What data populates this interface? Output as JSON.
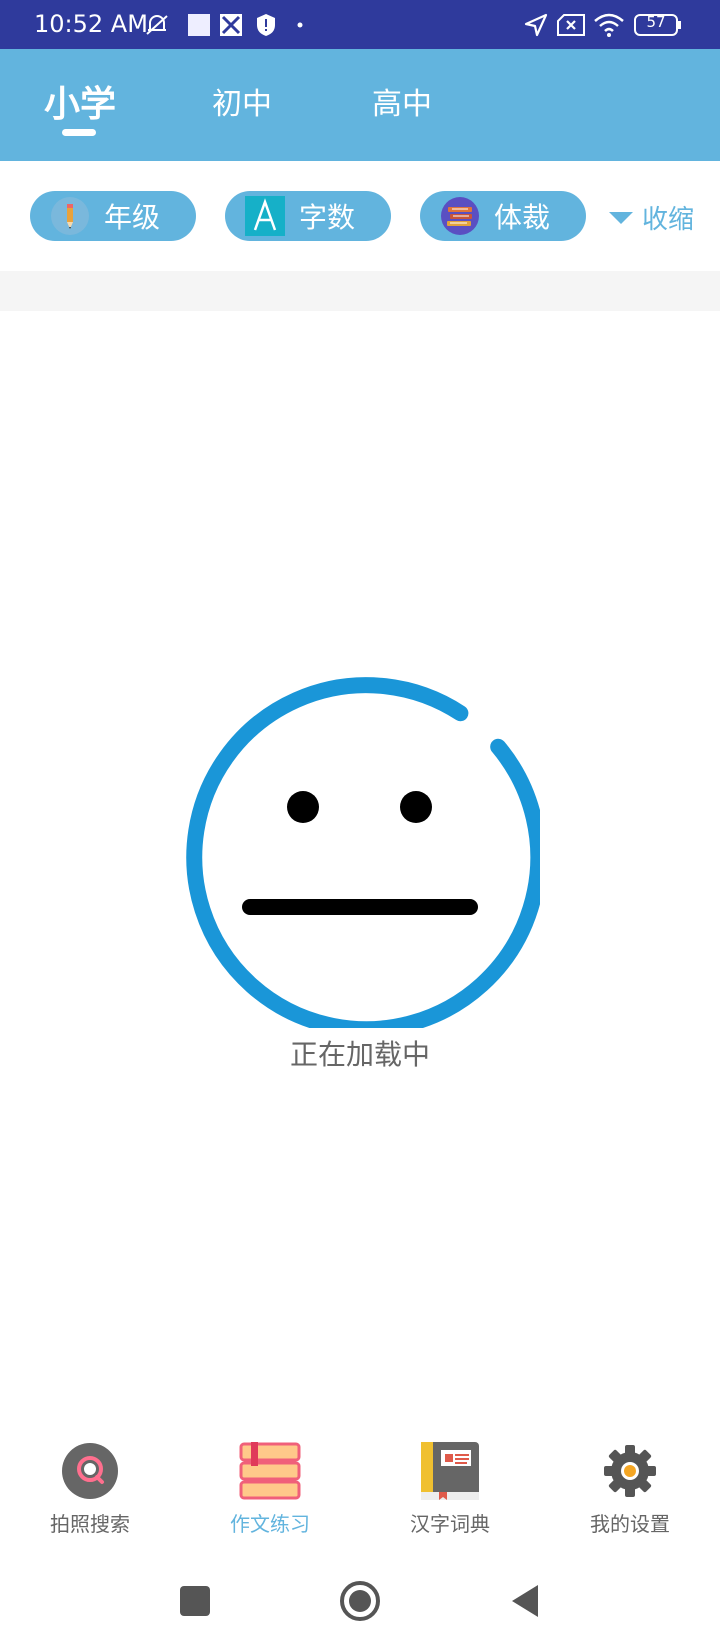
{
  "status": {
    "time": "10:52 AM",
    "battery": "57"
  },
  "tabs": [
    {
      "label": "小学",
      "active": true
    },
    {
      "label": "初中",
      "active": false
    },
    {
      "label": "高中",
      "active": false
    }
  ],
  "filters": {
    "chips": [
      {
        "label": "年级",
        "icon": "pencil-icon"
      },
      {
        "label": "字数",
        "icon": "letter-a-icon"
      },
      {
        "label": "体裁",
        "icon": "books-icon"
      }
    ],
    "collapse_label": "收缩"
  },
  "loading": {
    "text": "正在加载中"
  },
  "bottom_nav": [
    {
      "label": "拍照搜索",
      "icon": "search-camera-icon",
      "active": false
    },
    {
      "label": "作文练习",
      "icon": "books-stack-icon",
      "active": true
    },
    {
      "label": "汉字词典",
      "icon": "dictionary-icon",
      "active": false
    },
    {
      "label": "我的设置",
      "icon": "gear-icon",
      "active": false
    }
  ],
  "colors": {
    "status_bar": "#2f3a9c",
    "accent": "#62b4de",
    "loading_ring": "#1a96d8"
  }
}
